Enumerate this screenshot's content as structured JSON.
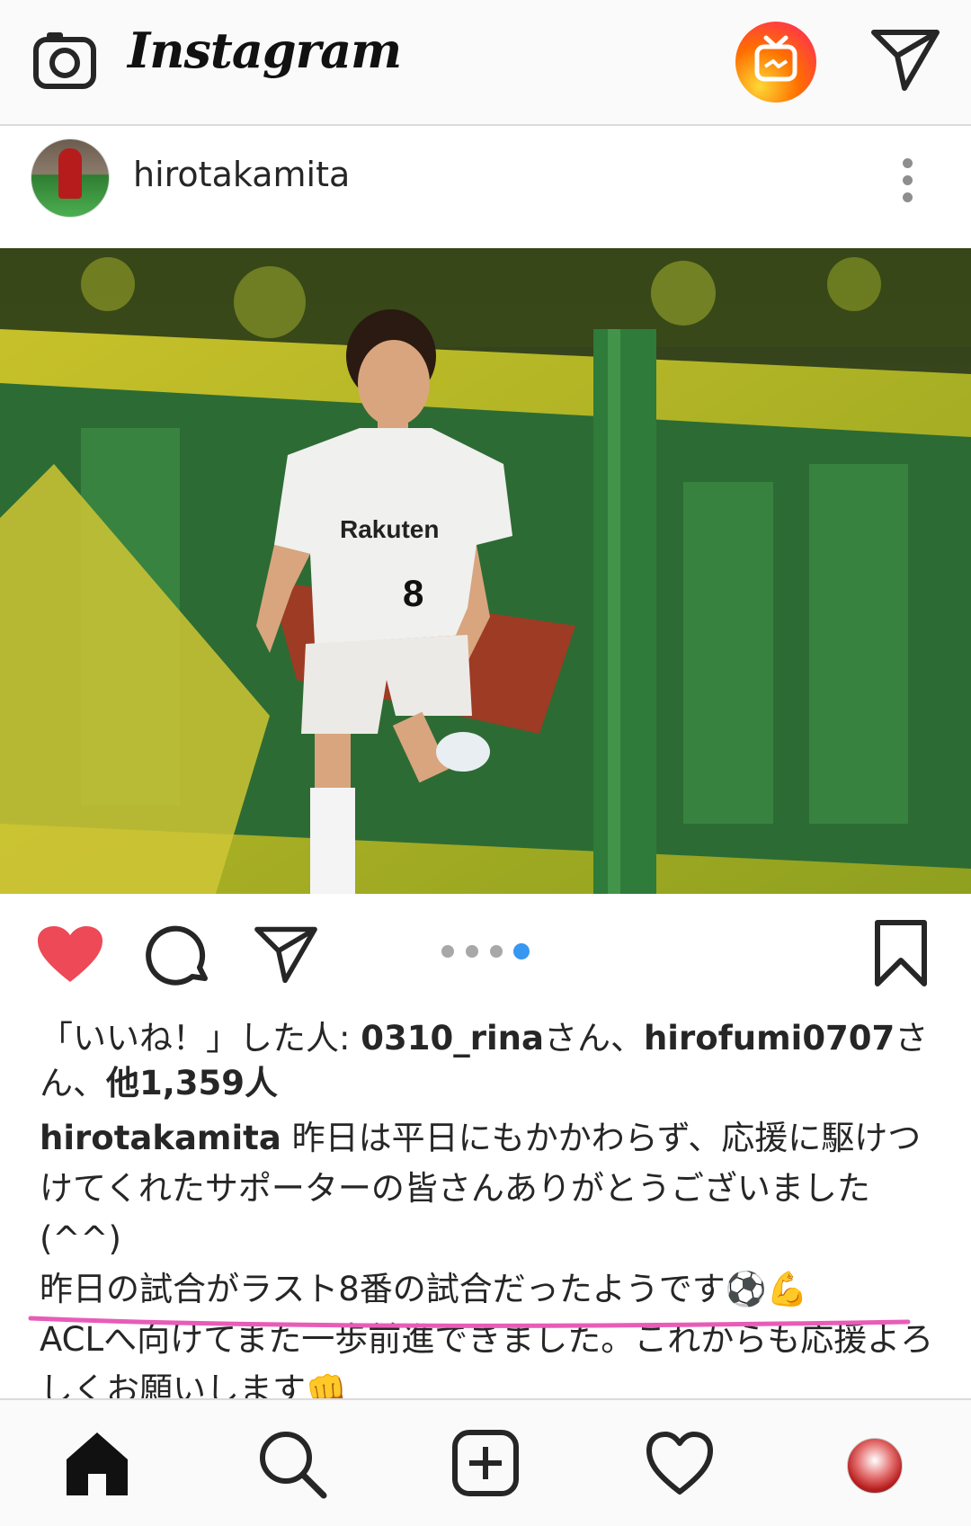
{
  "app": {
    "name": "Instagram",
    "accent_heart": "#ed4956",
    "accent_dot": "#3897f0",
    "underline_color": "#e85cb8"
  },
  "topbar": {
    "logo_text": "Instagram",
    "icons": [
      "camera-icon",
      "igtv-icon",
      "direct-send-icon"
    ]
  },
  "post": {
    "username": "hirotakamita",
    "carousel": {
      "total": 4,
      "active": 4
    },
    "liked": true,
    "likes_line": {
      "prefix": "「いいね！」した人: ",
      "user1": "0310_rina",
      "mid": "さん、",
      "user2": "hirofumi0707",
      "suffix": "さん、",
      "others": "他1,359人"
    },
    "caption": {
      "author": "hirotakamita",
      "line1": " 昨日は平日にもかかわらず、応援に駆けつけてくれたサポーターの皆さんありがとうございました(^^)",
      "line2": "昨日の試合がラスト8番の試合だったようです⚽💪",
      "line3": "ACLへ向けてまた一歩前進できました。これからも応援よろしくお願いします👊"
    }
  },
  "bottom_nav": [
    "home-icon",
    "search-icon",
    "new-post-icon",
    "activity-heart-icon",
    "profile-avatar"
  ]
}
